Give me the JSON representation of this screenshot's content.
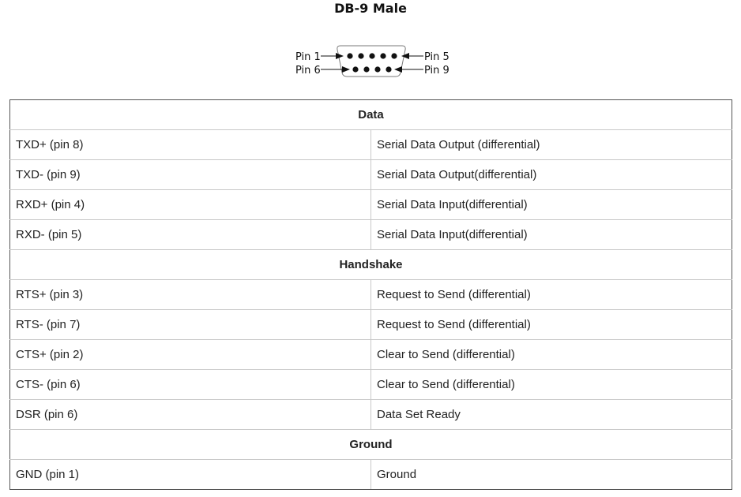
{
  "title": "DB-9 Male",
  "connector": {
    "pin_labels": {
      "top_left": "Pin 1",
      "top_right": "Pin 5",
      "bottom_left": "Pin 6",
      "bottom_right": "Pin 9"
    },
    "top_row_pins": 5,
    "bottom_row_pins": 4
  },
  "table": {
    "sections": [
      {
        "heading": "Data",
        "rows": [
          {
            "pin": "TXD+ (pin 8)",
            "description": "Serial Data Output (differential)"
          },
          {
            "pin": "TXD- (pin 9)",
            "description": "Serial Data Output(differential)"
          },
          {
            "pin": "RXD+ (pin 4)",
            "description": "Serial Data Input(differential)"
          },
          {
            "pin": "RXD- (pin 5)",
            "description": "Serial Data Input(differential)"
          }
        ]
      },
      {
        "heading": "Handshake",
        "rows": [
          {
            "pin": "RTS+ (pin 3)",
            "description": "Request to Send (differential)"
          },
          {
            "pin": "RTS- (pin 7)",
            "description": "Request to Send (differential)"
          },
          {
            "pin": "CTS+ (pin 2)",
            "description": "Clear to Send (differential)"
          },
          {
            "pin": "CTS- (pin 6)",
            "description": "Clear to Send (differential)"
          },
          {
            "pin": "DSR (pin 6)",
            "description": "Data Set Ready"
          }
        ]
      },
      {
        "heading": "Ground",
        "rows": [
          {
            "pin": "GND (pin 1)",
            "description": "Ground"
          }
        ]
      }
    ]
  }
}
